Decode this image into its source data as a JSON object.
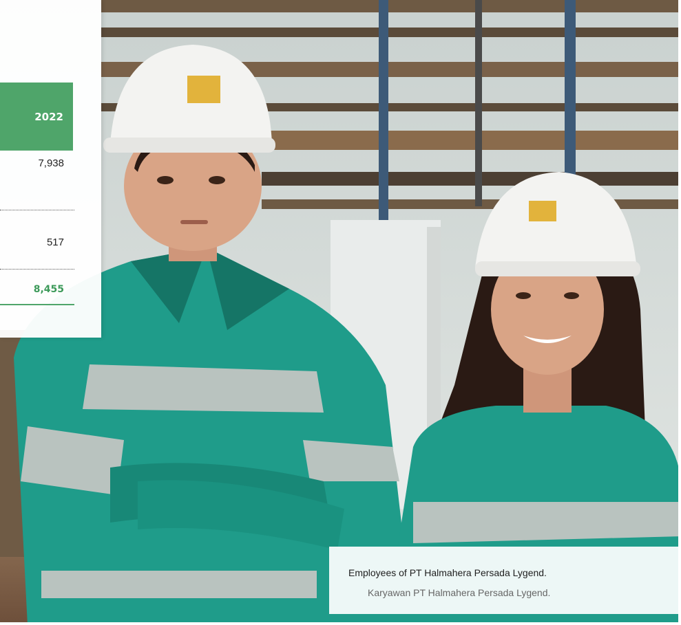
{
  "photo": {
    "subject": "two-workers-in-green-uniforms-and-white-hardhats",
    "colors": {
      "sky": "#d7dedc",
      "scaffold": "#6e5a44",
      "uniform": "#1f9c8a",
      "uniform_dark": "#157566",
      "reflective": "#b9c3bf",
      "hardhat": "#f3f3f1",
      "skin": "#d9a486",
      "hair": "#2a1a14",
      "logo": "#e2b33c"
    }
  },
  "table": {
    "year_header": "2022",
    "rows": [
      {
        "value": "7,938"
      },
      {
        "value": "517"
      }
    ],
    "total": "8,455",
    "accent": "#4fa56a"
  },
  "caption": {
    "english": "Employees of PT Halmahera Persada Lygend.",
    "indonesian": "Karyawan PT Halmahera Persada Lygend."
  }
}
